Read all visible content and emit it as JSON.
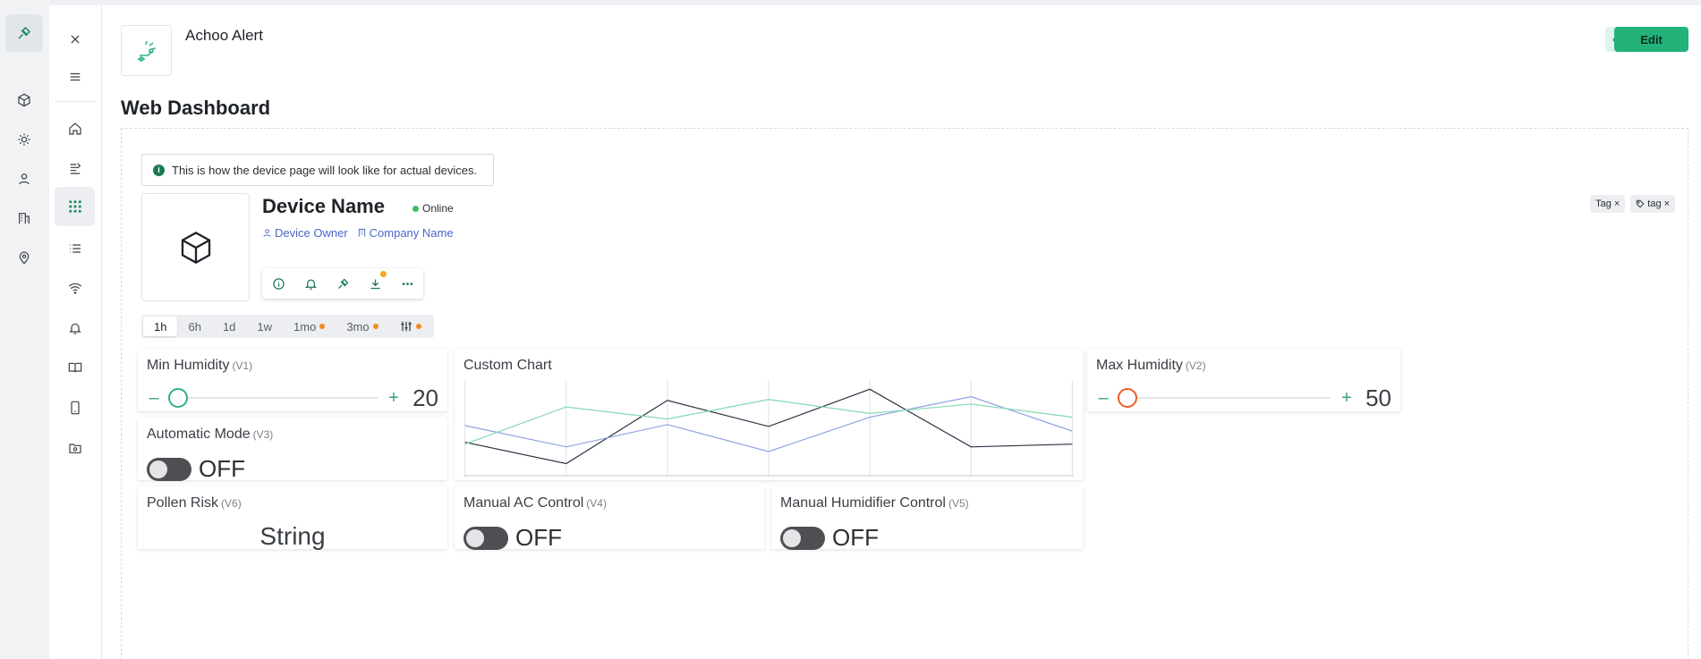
{
  "app": {
    "name": "Achoo Alert"
  },
  "header": {
    "more_label": "•••",
    "edit_label": "Edit"
  },
  "page": {
    "title": "Web Dashboard"
  },
  "info": {
    "icon": "i",
    "text": "This is how the device page will look like for actual devices."
  },
  "device": {
    "name": "Device Name",
    "status": "Online",
    "owner": "Device Owner",
    "company": "Company Name",
    "tags": [
      "Tag",
      "tag"
    ]
  },
  "tabs": [
    {
      "label": "1h",
      "active": true,
      "dot": false
    },
    {
      "label": "6h",
      "active": false,
      "dot": false
    },
    {
      "label": "1d",
      "active": false,
      "dot": false
    },
    {
      "label": "1w",
      "active": false,
      "dot": false
    },
    {
      "label": "1mo",
      "active": false,
      "dot": true
    },
    {
      "label": "3mo",
      "active": false,
      "dot": true
    }
  ],
  "widgets": {
    "min_humidity": {
      "title": "Min Humidity",
      "pin": "(V1)",
      "value": "20",
      "level": 0
    },
    "max_humidity": {
      "title": "Max Humidity",
      "pin": "(V2)",
      "value": "50",
      "level": 0
    },
    "custom_chart": {
      "title": "Custom Chart"
    },
    "automatic_mode": {
      "title": "Automatic Mode",
      "pin": "(V3)",
      "state": "OFF"
    },
    "pollen_risk": {
      "title": "Pollen Risk",
      "pin": "(V6)",
      "value": "String"
    },
    "manual_ac": {
      "title": "Manual AC Control",
      "pin": "(V4)",
      "state": "OFF"
    },
    "manual_humidifier": {
      "title": "Manual Humidifier Control",
      "pin": "(V5)",
      "state": "OFF"
    }
  },
  "chart_data": {
    "type": "line",
    "x": [
      0,
      1,
      2,
      3,
      4,
      5,
      6
    ],
    "ylim": [
      0,
      100
    ],
    "grid": true,
    "series": [
      {
        "color": "#2d3142",
        "values": [
          35,
          12,
          80,
          52,
          92,
          30,
          33
        ]
      },
      {
        "color": "#8ea3e0",
        "values": [
          53,
          30,
          54,
          25,
          62,
          84,
          47
        ]
      },
      {
        "color": "#84d8b6",
        "values": [
          33,
          73,
          60,
          81,
          66,
          76,
          62
        ]
      }
    ]
  },
  "colors": {
    "brand": "#23b27a",
    "min_knob": "#2fb383",
    "max_knob": "#f05a2a",
    "online": "#3bbf6b"
  }
}
